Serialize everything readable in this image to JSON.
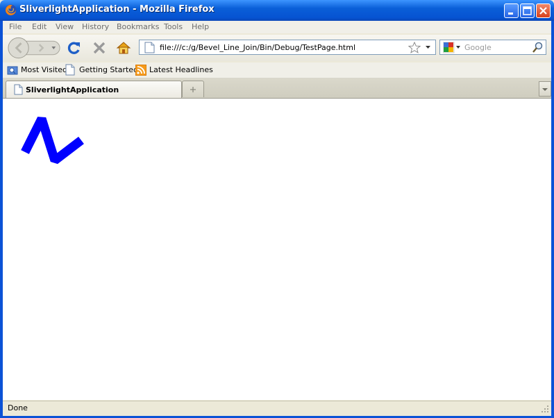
{
  "window": {
    "title": "SliverlightApplication - Mozilla Firefox"
  },
  "menu": {
    "items": [
      "File",
      "Edit",
      "View",
      "History",
      "Bookmarks",
      "Tools",
      "Help"
    ]
  },
  "navigation": {
    "url": "file:///c:/g/Bevel_Line_Join/Bin/Debug/TestPage.html",
    "search_placeholder": "Google"
  },
  "bookmarks": {
    "items": [
      "Most Visited",
      "Getting Started",
      "Latest Headlines"
    ]
  },
  "tabs": {
    "active_label": "SliverlightApplication"
  },
  "status": {
    "text": "Done"
  },
  "content": {
    "polyline_color": "#0000ff"
  },
  "icons": {
    "app": "firefox-icon",
    "minimize": "minimize-icon",
    "maximize": "maximize-icon",
    "close": "close-icon",
    "back": "back-arrow-icon",
    "forward": "forward-arrow-icon",
    "reload": "reload-icon",
    "stop": "stop-icon",
    "home": "home-icon",
    "page": "page-icon",
    "star": "star-icon",
    "search_engine": "google-icon",
    "search": "magnifier-icon",
    "rss": "rss-icon"
  }
}
